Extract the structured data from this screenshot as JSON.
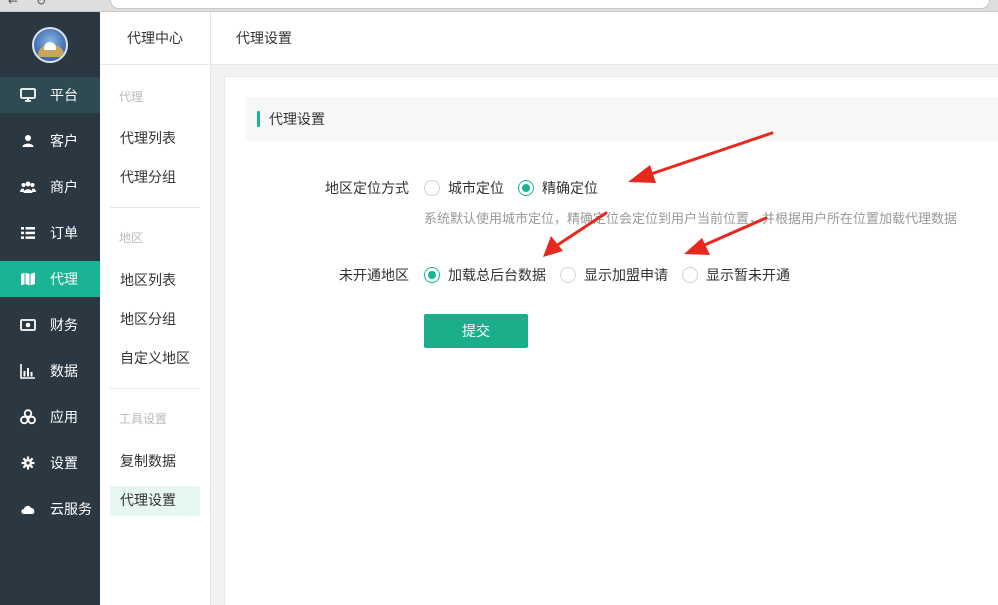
{
  "browser": {
    "back": "←",
    "reload": "↻"
  },
  "sidebar": {
    "items": [
      {
        "label": "平台",
        "icon": "monitor-icon"
      },
      {
        "label": "客户",
        "icon": "user-icon"
      },
      {
        "label": "商户",
        "icon": "users-icon"
      },
      {
        "label": "订单",
        "icon": "list-icon"
      },
      {
        "label": "代理",
        "icon": "map-icon"
      },
      {
        "label": "财务",
        "icon": "money-icon"
      },
      {
        "label": "数据",
        "icon": "bar-chart-icon"
      },
      {
        "label": "应用",
        "icon": "cubes-icon"
      },
      {
        "label": "设置",
        "icon": "gear-icon"
      },
      {
        "label": "云服务",
        "icon": "cloud-icon"
      }
    ],
    "active": "代理"
  },
  "submenu": {
    "title": "代理中心",
    "groups": [
      {
        "label": "代理",
        "items": [
          "代理列表",
          "代理分组"
        ]
      },
      {
        "label": "地区",
        "items": [
          "地区列表",
          "地区分组",
          "自定义地区"
        ]
      },
      {
        "label": "工具设置",
        "items": [
          "复制数据",
          "代理设置"
        ]
      }
    ],
    "selected": "代理设置"
  },
  "topbar": {
    "title": "代理设置"
  },
  "section": {
    "title": "代理设置"
  },
  "form": {
    "location_mode": {
      "label": "地区定位方式",
      "options": [
        "城市定位",
        "精确定位"
      ],
      "selected": "精确定位",
      "hint": "系统默认使用城市定位，精确定位会定位到用户当前位置，并根据用户所在位置加载代理数据"
    },
    "unopened_area": {
      "label": "未开通地区",
      "options": [
        "加载总后台数据",
        "显示加盟申请",
        "显示暂未开通"
      ],
      "selected": "加载总后台数据"
    },
    "submit_label": "提交"
  },
  "colors": {
    "accent": "#18b493",
    "sidebar_bg": "#2b3841",
    "arrow": "#e8281e"
  }
}
